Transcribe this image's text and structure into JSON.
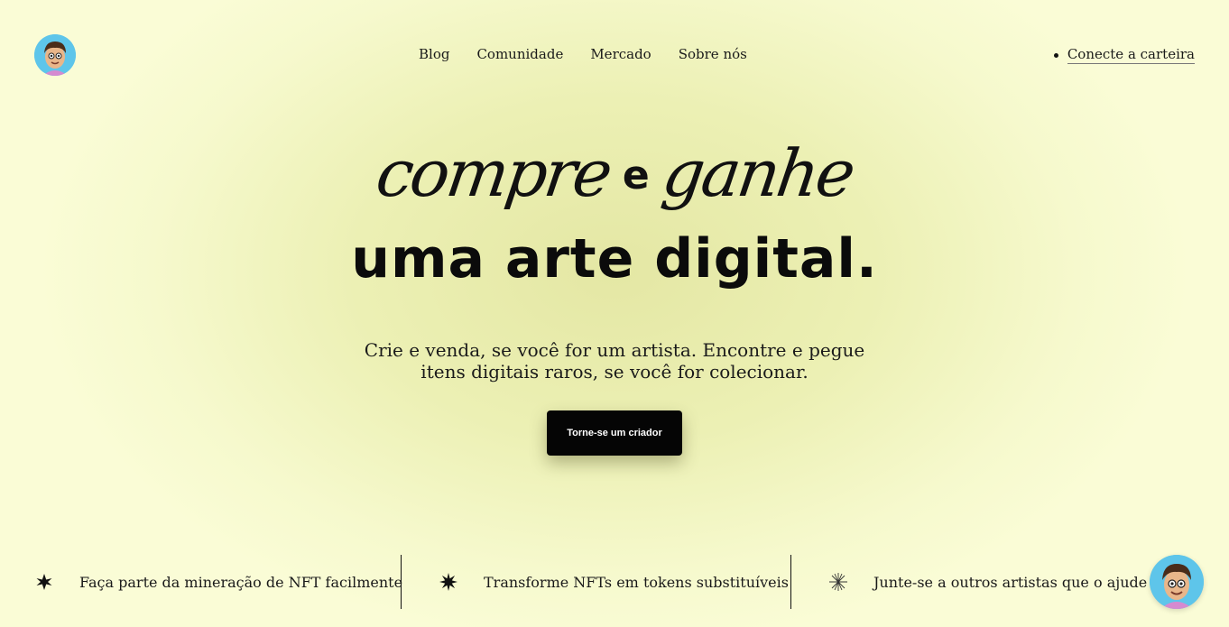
{
  "header": {
    "logo_avatar": "cartoon-avatar",
    "nav": [
      "Blog",
      "Comunidade",
      "Mercado",
      "Sobre nós"
    ],
    "wallet_link": "Conecte a carteira"
  },
  "hero": {
    "word1": "compre",
    "connector": "e",
    "word2": "ganhe",
    "line2": "uma arte digital.",
    "subtitle_line1": "Crie e venda, se você for um artista. Encontre e pegue",
    "subtitle_line2": "itens digitais raros, se você for colecionar.",
    "cta_label": "Torne-se um criador"
  },
  "features": [
    {
      "icon": "six-point-star-icon",
      "text": "Faça parte da mineração de NFT facilmente"
    },
    {
      "icon": "eight-point-star-icon",
      "text": "Transforme NFTs em tokens substituíveis"
    },
    {
      "icon": "sparkle-lines-icon",
      "text": "Junte-se a outros artistas que o ajude"
    }
  ],
  "chat_widget": {
    "icon": "cartoon-avatar"
  },
  "colors": {
    "background": "#f7facf",
    "accent_dark": "#050505",
    "avatar_bg": "#5ec5ea"
  }
}
